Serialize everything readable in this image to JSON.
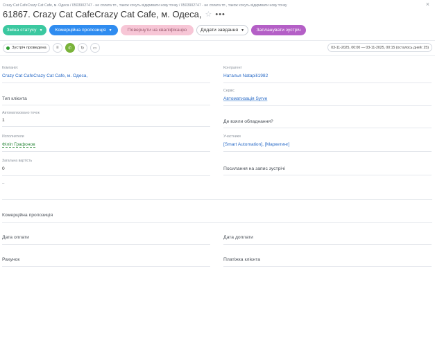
{
  "window": {
    "close_icon": "close-icon"
  },
  "breadcrumb": "Crazy Cat CafeCrazy Cat Cafe, м. Одеса / 0503902747 - не сплата тп , також хочуть відкривати нову точку / 0503902747 - не сплата тп , також хочуть відкривати нову точку",
  "title": "61867. Crazy Cat CafeCrazy Cat Cafe, м. Одеса,",
  "toolbar": {
    "status_change": "Зміна статусу",
    "commercial_offer": "Комерційна пропозиція",
    "return_qualification": "Повернути на кваліфікацію",
    "add_task": "Додати завдання",
    "schedule_meeting": "Запланувати зустріч"
  },
  "subbar": {
    "status": "Зустріч проведена",
    "date_range": "03-11-2025, 00:00 — 03-11-2025, 00:15 (осталось дней: 25)"
  },
  "colors": {
    "green": "#3bc8a0",
    "blue": "#2f8cf0",
    "pink": "#f7c6d6",
    "purple": "#b45fc6"
  },
  "fields": {
    "company_label": "Компанія:",
    "company_value": "Crazy Cat CafeCrazy Cat Cafe, м. Одеса,",
    "counterparty_label": "Контрагент",
    "counterparty_value": "Наталья Natapili1982",
    "client_type_label": "Тип клієнта",
    "service_label": "Сервіс",
    "service_value": "Автоматизація Syrve",
    "points_label": "Автоматизовано точок",
    "points_value": "1",
    "equipment_label": "Де взяли обладнання?",
    "executors_label": "Исполнители",
    "executors_value": "Філіп Графонов",
    "participants_label": "Участники",
    "participants_value": "[Smart Automation], [Маркетинг]",
    "total_label": "Загальна вартість",
    "total_value": "0",
    "meeting_link_label": "Посилання на запис зустрічі",
    "dash": "--",
    "commercial_offer_label": "Комерційна пропозиція",
    "payment_date_label": "Дата оплати",
    "surcharge_date_label": "Дата доплати",
    "account_label": "Рахунок",
    "payer_label": "Платіжка клієнта"
  }
}
